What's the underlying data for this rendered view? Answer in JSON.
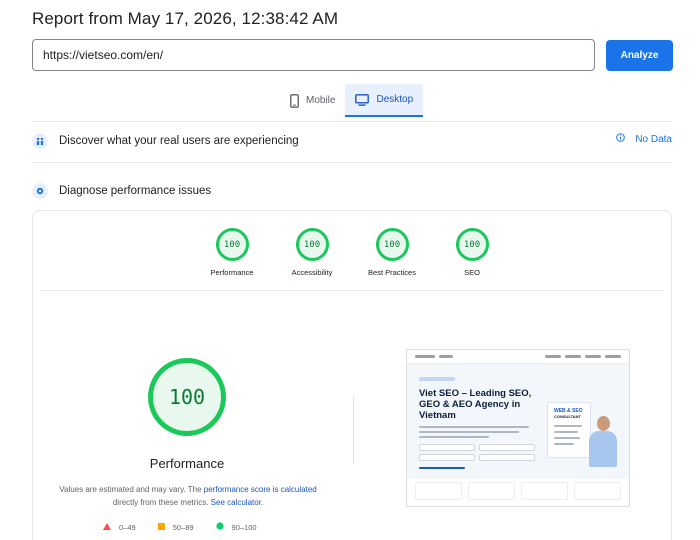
{
  "report": {
    "title": "Report from May 17, 2026, 12:38:42 AM"
  },
  "search": {
    "url": "https://vietseo.com/en/",
    "analyze_label": "Analyze"
  },
  "tabs": [
    {
      "label": "Mobile",
      "icon": "phone-icon",
      "active": false
    },
    {
      "label": "Desktop",
      "icon": "monitor-icon",
      "active": true
    }
  ],
  "discover": {
    "title": "Discover what your real users are experiencing",
    "status": "No Data",
    "icon": "people-icon"
  },
  "diagnose": {
    "title": "Diagnose performance issues",
    "icon": "lightning-icon"
  },
  "scores": [
    {
      "value": "100",
      "label": "Performance"
    },
    {
      "value": "100",
      "label": "Accessibility"
    },
    {
      "value": "100",
      "label": "Best Practices"
    },
    {
      "value": "100",
      "label": "SEO"
    }
  ],
  "main_score": {
    "value": "100",
    "label": "Performance",
    "note_prefix": "Values are estimated and may vary. The ",
    "link_score": "performance score is calculated",
    "note_middle": " directly from these metrics. ",
    "link_calc": "See calculator."
  },
  "legend": [
    {
      "range": "0–49",
      "shape": "triangle",
      "color": "#ff4e42"
    },
    {
      "range": "50–89",
      "shape": "square",
      "color": "#ffa400"
    },
    {
      "range": "90–100",
      "shape": "circle",
      "color": "#0cce6b"
    }
  ],
  "preview": {
    "headline": "Viet SEO – Leading SEO, GEO & AEO Agency in Vietnam",
    "card_title": "WEB & SEO",
    "card_subtitle": "CONSULTANT"
  },
  "colors": {
    "accent": "#1a73e8",
    "pass": "#0cce6b"
  }
}
